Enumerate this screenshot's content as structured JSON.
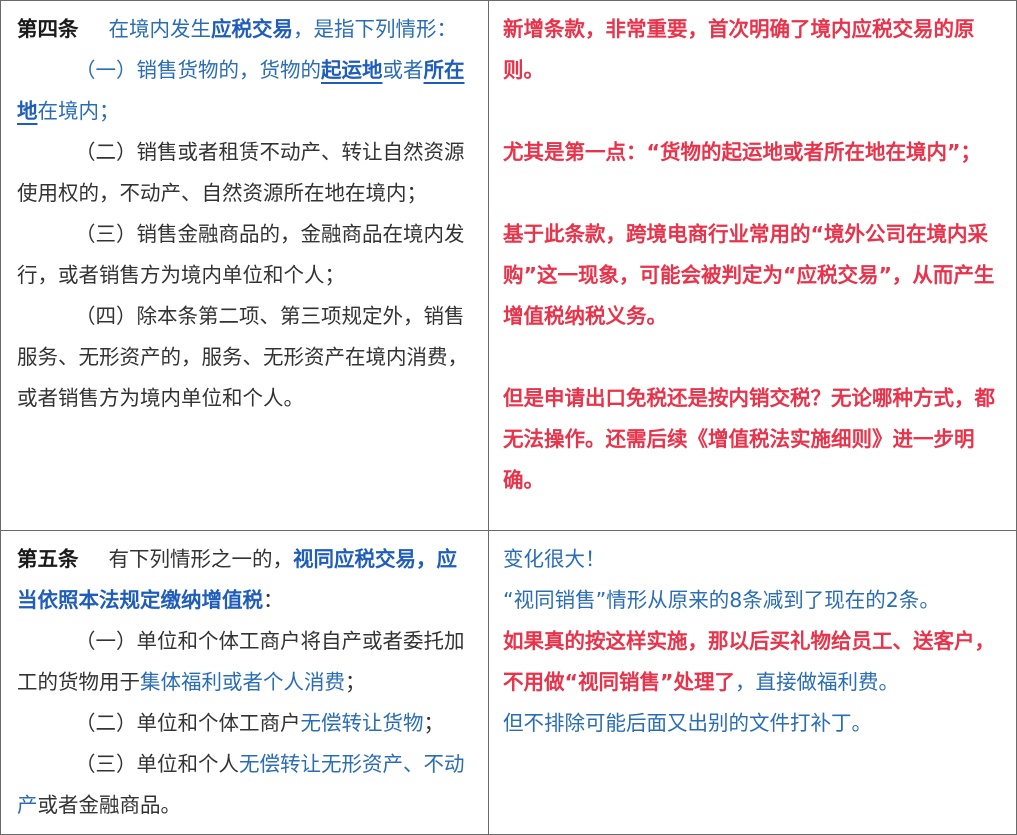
{
  "article4": {
    "heading": "第四条",
    "intro_1": "在境内发生",
    "intro_key": "应税交易",
    "intro_2": "，是指下列情形：",
    "item1_a": "（一）销售货物的，货物的",
    "item1_key1": "起运地",
    "item1_mid": "或者",
    "item1_key2": "所在地",
    "item1_b": "在境内；",
    "item2": "（二）销售或者租赁不动产、转让自然资源使用权的，不动产、自然资源所在地在境内；",
    "item3": "（三）销售金融商品的，金融商品在境内发行，或者销售方为境内单位和个人；",
    "item4": "（四）除本条第二项、第三项规定外，销售服务、无形资产的，服务、无形资产在境内消费，或者销售方为境内单位和个人。"
  },
  "comment4": {
    "p1": "新增条款，非常重要，首次明确了境内应税交易的原则。",
    "p2": "尤其是第一点：“货物的起运地或者所在地在境内”；",
    "p3": "基于此条款，跨境电商行业常用的“境外公司在境内采购”这一现象，可能会被判定为“应税交易”，从而产生增值税纳税义务。",
    "p4": "但是申请出口免税还是按内销交税？无论哪种方式，都无法操作。还需后续《增值税法实施细则》进一步明确。"
  },
  "article5": {
    "heading": "第五条",
    "intro_1": "有下列情形之一的，",
    "intro_key": "视同应税交易，应当依照本法规定缴纳增值税",
    "intro_2": "：",
    "item1_a": "（一）单位和个体工商户将自产或者委托加工的货物用于",
    "item1_key": "集体福利或者个人消费",
    "item1_b": "；",
    "item2_a": "（二）单位和个体工商户",
    "item2_key": "无偿转让货物",
    "item2_b": "；",
    "item3_a": "（三）单位和个人",
    "item3_key": "无偿转让无形资产、不动产",
    "item3_b": "或者金融商品。"
  },
  "comment5": {
    "p1": "变化很大！",
    "p2": "“视同销售”情形从原来的8条减到了现在的2条。",
    "p3_red": "如果真的按这样实施，那以后买礼物给员工、送客户，不用做“视同销售”处理了",
    "p3_tail": "，直接做福利费。",
    "p4": "但不排除可能后面又出别的文件打补丁。"
  }
}
